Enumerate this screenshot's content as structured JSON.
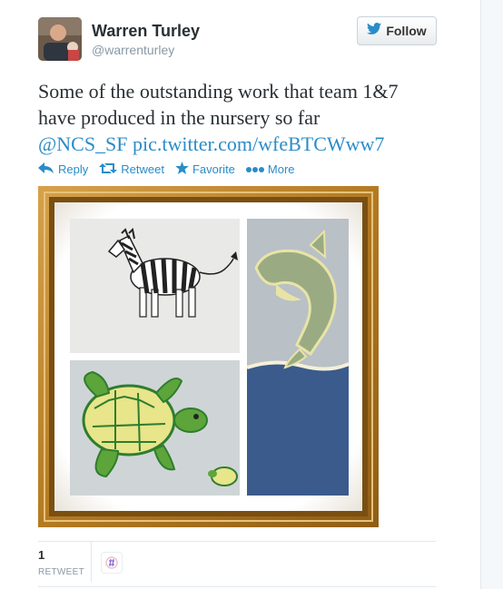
{
  "user": {
    "name": "Warren Turley",
    "handle": "@warrenturley"
  },
  "follow_button": {
    "label": "Follow"
  },
  "tweet": {
    "text_line1": "Some of the outstanding work that team 1&7",
    "text_line2": "have produced in the nursery so far",
    "mention": "@NCS_SF",
    "link": "pic.twitter.com/wfeBTCWww7"
  },
  "actions": [
    {
      "label": "Reply",
      "icon": "reply-icon"
    },
    {
      "label": "Retweet",
      "icon": "retweet-icon"
    },
    {
      "label": "Favorite",
      "icon": "star-icon"
    },
    {
      "label": "More",
      "icon": "more-dots-icon"
    }
  ],
  "stats": {
    "retweet_count": "1",
    "retweet_label": "RETWEET"
  },
  "colors": {
    "link": "#2a8cc8",
    "name": "#292f33",
    "muted": "#8899a6",
    "frame": "#b8862a"
  }
}
